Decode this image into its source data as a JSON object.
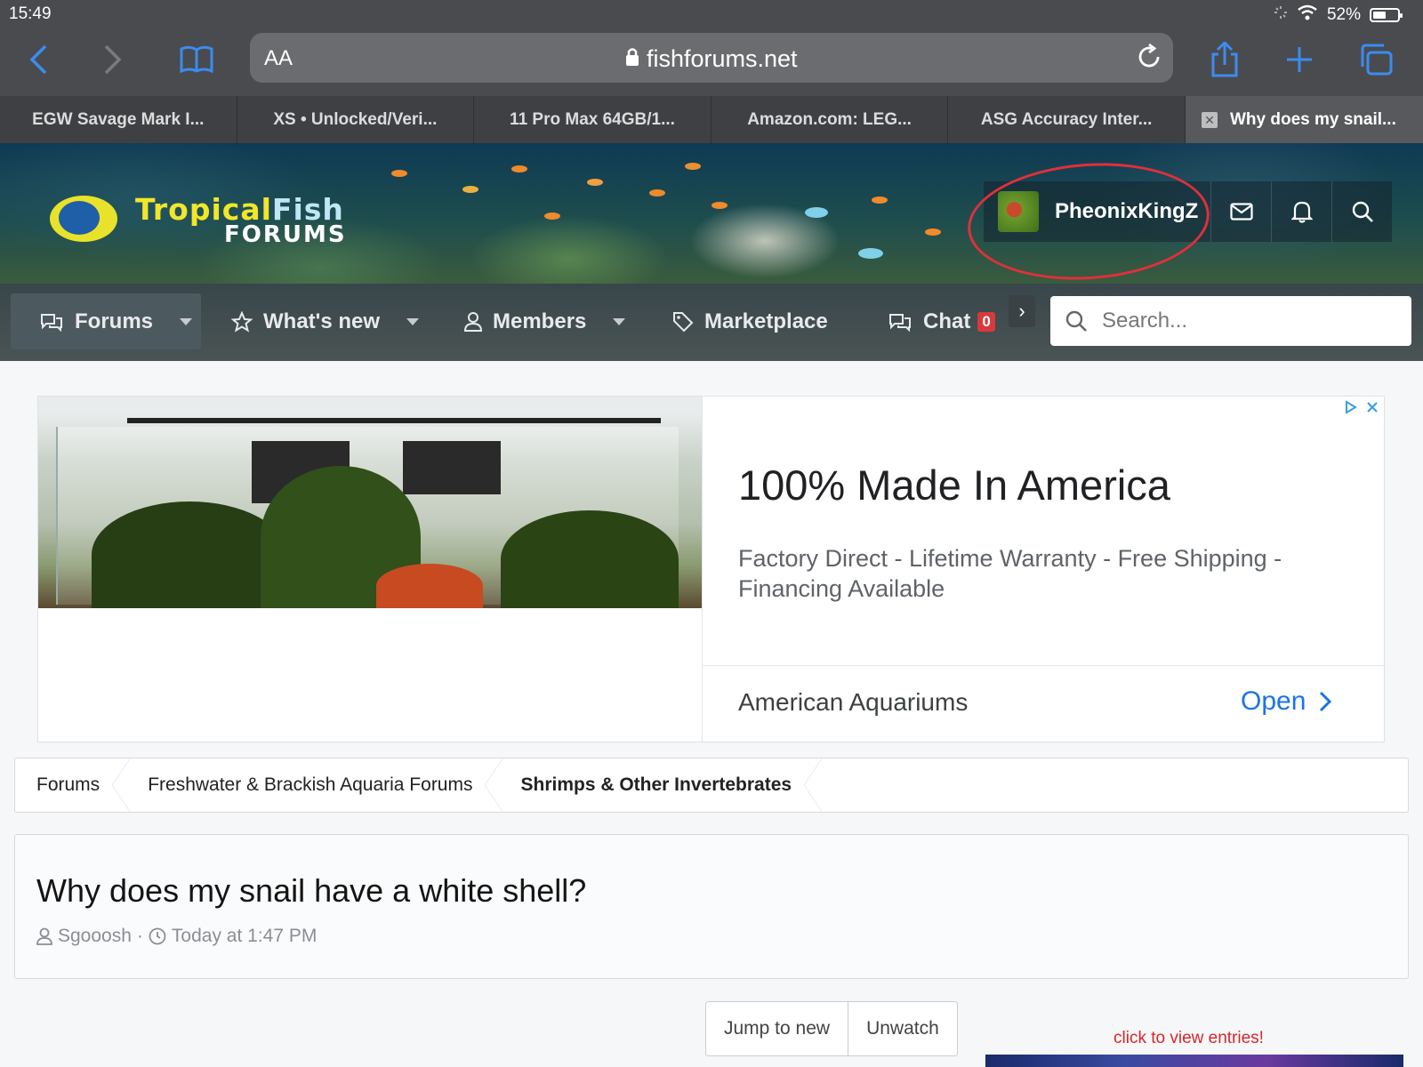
{
  "status": {
    "time": "15:49",
    "battery": "52%"
  },
  "browser": {
    "text_size_label": "AA",
    "url": "fishforums.net",
    "tabs": [
      {
        "label": "EGW Savage Mark I..."
      },
      {
        "label": "XS • Unlocked/Veri..."
      },
      {
        "label": "11 Pro Max 64GB/1..."
      },
      {
        "label": "Amazon.com: LEG..."
      },
      {
        "label": "ASG Accuracy Inter..."
      },
      {
        "label": "Why does my snail...",
        "active": true
      }
    ]
  },
  "site": {
    "logo_line1_a": "Tropical",
    "logo_line1_b": "Fish",
    "logo_line2": "FORUMS",
    "username": "PheonixKingZ"
  },
  "nav": {
    "items": [
      {
        "label": "Forums"
      },
      {
        "label": "What's new"
      },
      {
        "label": "Members"
      },
      {
        "label": "Marketplace"
      },
      {
        "label": "Chat"
      }
    ],
    "chat_count": "0",
    "search_placeholder": "Search..."
  },
  "ad": {
    "title": "100% Made In America",
    "description": "Factory Direct - Lifetime Warranty - Free Shipping - Financing Available",
    "brand": "American Aquariums",
    "cta": "Open"
  },
  "breadcrumb": [
    "Forums",
    "Freshwater & Brackish Aquaria Forums",
    "Shrimps & Other Invertebrates"
  ],
  "thread": {
    "title": "Why does my snail have a white shell?",
    "author": "Sgooosh",
    "separator": "·",
    "time": "Today at 1:47 PM"
  },
  "actions": {
    "jump_label": "Jump to new",
    "watch_label": "Unwatch"
  },
  "sidebar": {
    "entries_link": "click to view entries!"
  },
  "colors": {
    "accent": "#1a73e8",
    "badge": "#d83a3a",
    "annotation": "#e0303a"
  }
}
